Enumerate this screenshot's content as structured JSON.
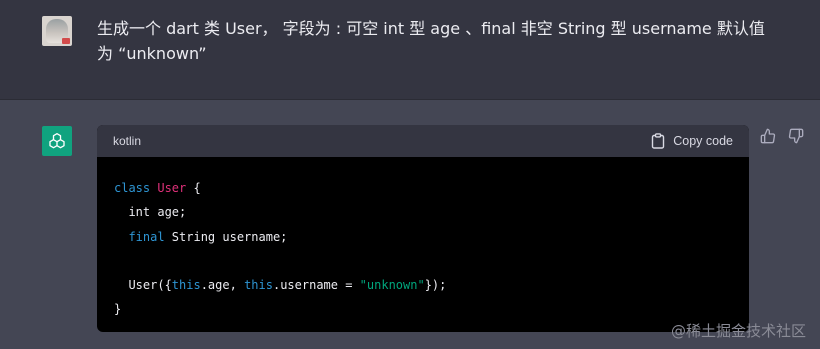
{
  "user": {
    "message_line1": "生成一个 dart 类 User， 字段为 : 可空 int 型 age 、final 非空 String 型 username 默认值",
    "message_line2": "为 “unknown”"
  },
  "code": {
    "language": "kotlin",
    "copy_label": "Copy code",
    "lines": {
      "l1_kw": "class",
      "l1_cls": "User",
      "l1_rest": " {",
      "l2": "  int age;",
      "l3_kw": "final",
      "l3_rest": " String username;",
      "l5_start": "  User({",
      "l5_this1": "this",
      "l5_mid": ".age, ",
      "l5_this2": "this",
      "l5_mid2": ".username = ",
      "l5_str": "\"unknown\"",
      "l5_end": "});",
      "l6": "}"
    }
  },
  "colors": {
    "keyword": "#2e95d3",
    "class_name": "#df3079",
    "string": "#00a67d",
    "assistant_avatar": "#10a37f"
  },
  "icons": {
    "assistant": "openai-logo-icon",
    "copy": "clipboard-icon",
    "thumbs_up": "thumbs-up-icon",
    "thumbs_down": "thumbs-down-icon"
  },
  "watermark": "@稀土掘金技术社区"
}
